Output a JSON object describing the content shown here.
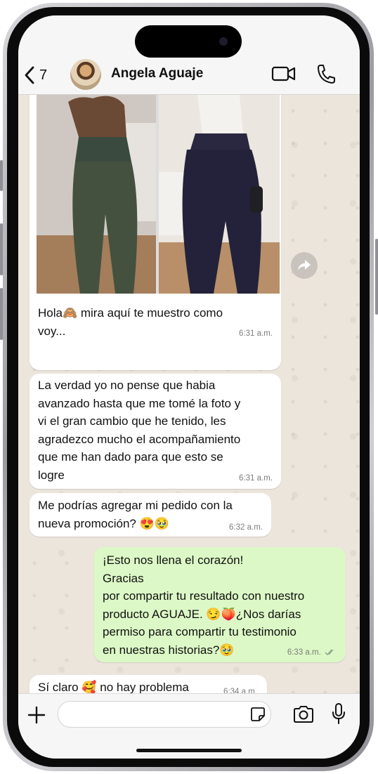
{
  "header": {
    "back_count": "7",
    "contact_name": "Angela Aguaje"
  },
  "messages": [
    {
      "text": "Hola🙈 mira aquí te muestro como\nvoy...",
      "time": "6:31 a.m."
    },
    {
      "text": "La verdad yo no pense que habia\navanzado hasta que me tomé la foto y\nvi el gran cambio que he tenido, les\nagradezco mucho el acompañamiento\nque me han dado para que esto se\nlogre",
      "time": "6:31 a.m."
    },
    {
      "text": "Me podrías agregar mi pedido con la\nnueva promoción? 😍🥹",
      "time": "6:32 a.m."
    },
    {
      "text": "¡Esto nos llena el corazón!\nGracias\npor compartir tu resultado con nuestro\nproducto AGUAJE. 😏🍑¿Nos darías\npermiso para compartir tu testimonio\nen nuestras historias?🥹",
      "time": "6:33 a.m."
    },
    {
      "text": "Sí claro 🥰 no hay problema",
      "time": "6:34 a.m."
    }
  ],
  "colors": {
    "incoming_bubble": "#ffffff",
    "outgoing_bubble": "#dcf8c6",
    "chat_background": "#ece5dc",
    "read_ticks": "#53bdeb"
  },
  "icons": {
    "back": "chevron-left-icon",
    "video": "video-camera-icon",
    "call": "phone-icon",
    "forward": "forward-arrow-icon",
    "attach": "plus-icon",
    "sticker": "sticker-icon",
    "camera": "camera-icon",
    "mic": "microphone-icon"
  }
}
